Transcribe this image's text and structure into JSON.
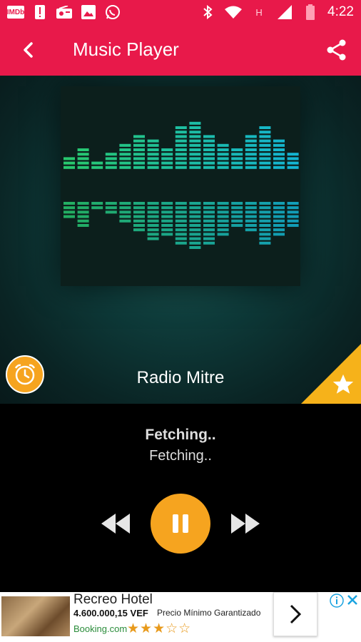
{
  "status_bar": {
    "time": "4:22",
    "network_label": "H",
    "left_icons": [
      "imdb-icon",
      "alert-icon",
      "radio-icon",
      "image-icon",
      "whatsapp-icon"
    ],
    "right_icons": [
      "bluetooth-icon",
      "wifi-icon",
      "signal-icon",
      "battery-icon"
    ],
    "imdb_text": "IMDb"
  },
  "toolbar": {
    "title": "Music Player",
    "back_icon": "back-arrow-icon",
    "share_icon": "share-icon",
    "color": "#e8194a"
  },
  "player": {
    "station_name": "Radio Mitre",
    "track_title": "Fetching..",
    "track_artist": "Fetching..",
    "accent": "#f6a41f",
    "controls": [
      "rewind-icon",
      "pause-icon",
      "fast-forward-icon"
    ]
  },
  "ad": {
    "title": "Recreo Hotel",
    "price": "4.600.000,15 VEF",
    "tagline": "Precio Mínimo Garantizado",
    "source": "Booking.com",
    "stars": "★★★☆☆",
    "rating": 3,
    "rating_max": 5
  }
}
